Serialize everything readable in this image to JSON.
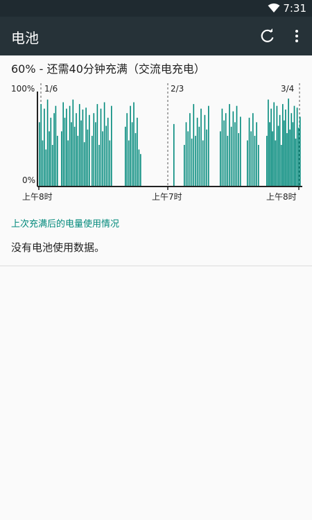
{
  "status_bar": {
    "time": "7:31",
    "icons": [
      "wifi-icon",
      "battery-icon"
    ]
  },
  "app_bar": {
    "title": "电池",
    "actions": [
      "refresh-icon",
      "more-vert-icon"
    ]
  },
  "charge_summary": "60% - 还需40分钟充满（交流电充电）",
  "chart_data": {
    "type": "bar",
    "y_labels": {
      "top": "100%",
      "bottom": "0%"
    },
    "dates": [
      "1/6",
      "2/3",
      "3/4"
    ],
    "x_labels": [
      "上午8时",
      "上午7时",
      "上午8时"
    ],
    "ylim": [
      0,
      100
    ],
    "color": "#00897b",
    "note": "",
    "groups": [
      {
        "x_range": [
          56,
          82
        ],
        "values": [
          70,
          90,
          50,
          85,
          40,
          95,
          60,
          75,
          45,
          80,
          88,
          55
        ]
      },
      {
        "x_range": [
          88,
          128
        ],
        "values": [
          60,
          92,
          75,
          85,
          50,
          88,
          70,
          95,
          65,
          80,
          55,
          90,
          72,
          84,
          48,
          86,
          62,
          78
        ]
      },
      {
        "x_range": [
          132,
          160
        ],
        "values": [
          55,
          80,
          70,
          90,
          45,
          85,
          60,
          92,
          66,
          75,
          50,
          88
        ]
      },
      {
        "x_range": [
          180,
          202
        ],
        "values": [
          65,
          80,
          50,
          88,
          70,
          92,
          58,
          75,
          40,
          35
        ]
      },
      {
        "x_range": [
          250,
          253
        ],
        "values": [
          68
        ]
      },
      {
        "x_range": [
          265,
          300
        ],
        "values": [
          45,
          70,
          60,
          80,
          52,
          90,
          55,
          75,
          65,
          85,
          50,
          78,
          62,
          88
        ]
      },
      {
        "x_range": [
          317,
          346
        ],
        "values": [
          60,
          85,
          72,
          80,
          55,
          90,
          65,
          82,
          70,
          88,
          58,
          76
        ]
      },
      {
        "x_range": [
          356,
          372
        ],
        "values": [
          50,
          75,
          60,
          80,
          55,
          70,
          45
        ]
      },
      {
        "x_range": [
          384,
          432
        ],
        "values": [
          55,
          95,
          70,
          85,
          60,
          92,
          50,
          88,
          66,
          78,
          45,
          90,
          72,
          84,
          58,
          96,
          62,
          80,
          70,
          88,
          52,
          86,
          64,
          76
        ]
      }
    ]
  },
  "usage_section": {
    "title": "上次充满后的电量使用情况",
    "empty_message": "没有电池使用数据。"
  }
}
